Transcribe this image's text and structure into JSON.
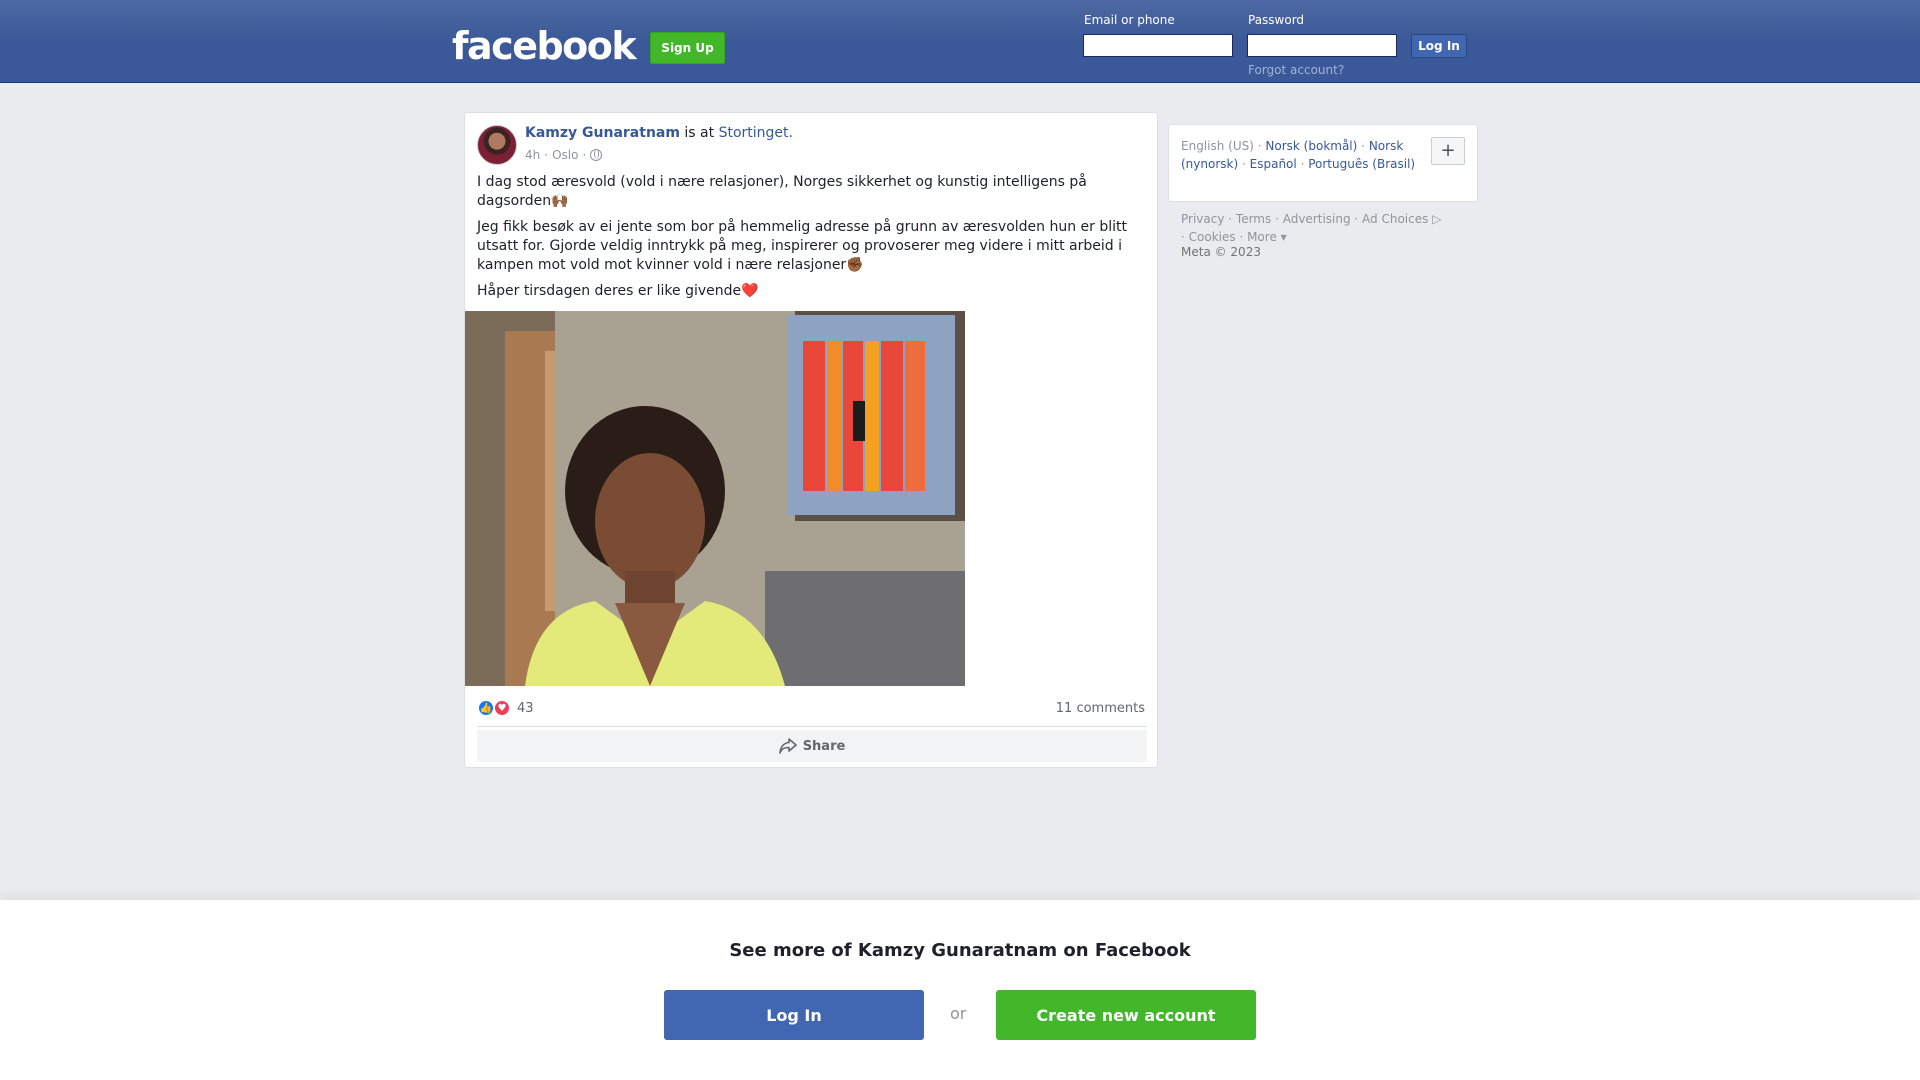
{
  "header": {
    "logo": "facebook",
    "signup_label": "Sign Up",
    "email_label": "Email or phone",
    "password_label": "Password",
    "email_value": "",
    "password_value": "",
    "login_label": "Log In",
    "forgot_label": "Forgot account?"
  },
  "post": {
    "author": "Kamzy Gunaratnam",
    "is_at": "is at",
    "place": "Stortinget.",
    "time": "4h",
    "sep1": "·",
    "location": "Oslo",
    "sep2": "·",
    "paragraphs": [
      "I dag stod æresvold (vold i nære relasjoner), Norges sikkerhet og kunstig intelligens på dagsorden🙌🏾",
      "Jeg fikk besøk av ei jente som bor på hemmelig adresse på grunn av æresvolden hun er blitt utsatt for. Gjorde veldig inntrykk på meg, inspirerer og provoserer meg videre i mitt arbeid i kampen mot vold mot kvinner vold i nære relasjoner✊🏾",
      "Håper tirsdagen deres er like givende❤️"
    ],
    "reaction_count": "43",
    "comments": "11 comments",
    "share_label": "Share"
  },
  "sidebar": {
    "languages": {
      "current": "English (US)",
      "sep": "·",
      "links": [
        "Norsk (bokmål)",
        "Norsk (nynorsk)",
        "Español",
        "Português (Brasil)"
      ]
    },
    "plus": "+",
    "footer": {
      "links": [
        "Privacy",
        "Terms",
        "Advertising",
        "Ad Choices",
        "Cookies",
        "More"
      ],
      "copyright": "Meta © 2023"
    }
  },
  "bottom_banner": {
    "title": "See more of Kamzy Gunaratnam on Facebook",
    "login_label": "Log In",
    "or_label": "or",
    "create_label": "Create new account"
  },
  "colors": {
    "brand": "#3b5998",
    "login_button": "#4267b2",
    "create_button": "#42b72a",
    "link": "#365899"
  }
}
